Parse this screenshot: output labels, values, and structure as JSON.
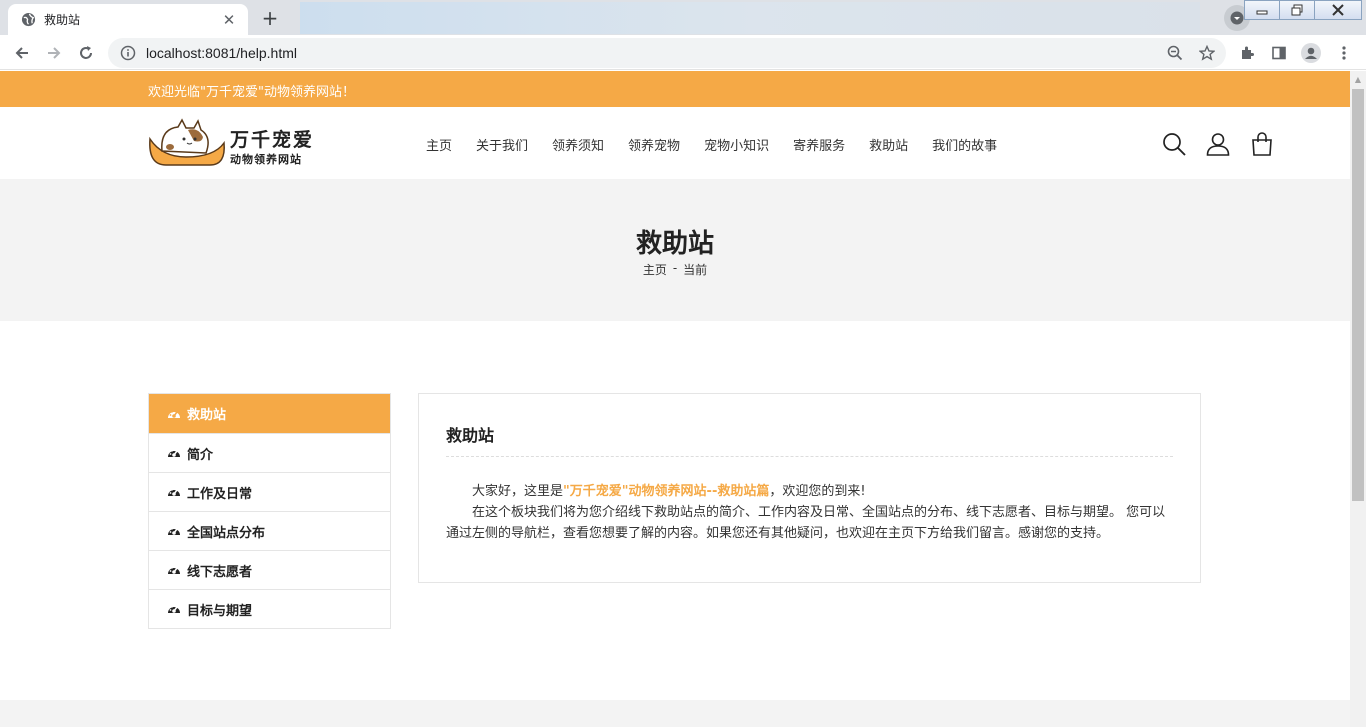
{
  "browser": {
    "tab_title": "救助站",
    "new_tab_symbol": "+",
    "close_symbol": "✕",
    "url": "localhost:8081/help.html"
  },
  "site": {
    "welcome": "欢迎光临\"万千宠爱\"动物领养网站！",
    "logo": {
      "title": "万千宠爱",
      "subtitle": "动物领养网站"
    },
    "nav": [
      "主页",
      "关于我们",
      "领养须知",
      "领养宠物",
      "宠物小知识",
      "寄养服务",
      "救助站",
      "我们的故事"
    ],
    "header_icons": [
      "search-icon",
      "user-icon",
      "cart-icon"
    ],
    "accent_color": "#f5a946"
  },
  "banner": {
    "title": "救助站",
    "breadcrumb": {
      "home": "主页",
      "separator": "-",
      "current": "当前"
    }
  },
  "sidebar": {
    "items": [
      {
        "label": "救助站",
        "active": true
      },
      {
        "label": "简介",
        "active": false
      },
      {
        "label": "工作及日常",
        "active": false
      },
      {
        "label": "全国站点分布",
        "active": false
      },
      {
        "label": "线下志愿者",
        "active": false
      },
      {
        "label": "目标与期望",
        "active": false
      }
    ]
  },
  "content": {
    "title": "救助站",
    "p1_prefix": "大家好，这里是",
    "p1_highlight": "\"万千宠爱\"动物领养网站--救助站篇",
    "p1_suffix": "，欢迎您的到来!",
    "p2": "在这个板块我们将为您介绍线下救助站点的简介、工作内容及日常、全国站点的分布、线下志愿者、目标与期望。 您可以通过左侧的导航栏，查看您想要了解的内容。如果您还有其他疑问，也欢迎在主页下方给我们留言。感谢您的支持。"
  }
}
